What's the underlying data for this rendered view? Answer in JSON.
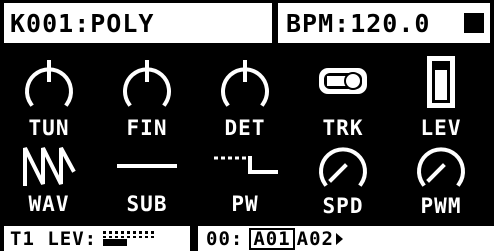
{
  "header": {
    "preset": "K001:POLY",
    "bpm": "BPM:120.0"
  },
  "params_row1": [
    {
      "label": "TUN",
      "icon": "knob-icon"
    },
    {
      "label": "FIN",
      "icon": "knob-icon"
    },
    {
      "label": "DET",
      "icon": "knob-icon"
    },
    {
      "label": "TRK",
      "icon": "toggle-switch-icon"
    },
    {
      "label": "LEV",
      "icon": "fader-icon"
    }
  ],
  "params_row2": [
    {
      "label": "WAV",
      "icon": "sawtooth-wave-icon"
    },
    {
      "label": "SUB",
      "icon": "sub-line-icon"
    },
    {
      "label": "PW",
      "icon": "pulse-width-icon"
    },
    {
      "label": "SPD",
      "icon": "knob-icon"
    },
    {
      "label": "PWM",
      "icon": "knob-icon"
    }
  ],
  "footer": {
    "track_level_label": "T1 LEV:",
    "track_level_value": 0.45,
    "pattern_prefix": "00:",
    "pattern_current": "A01",
    "pattern_next": "A02"
  }
}
